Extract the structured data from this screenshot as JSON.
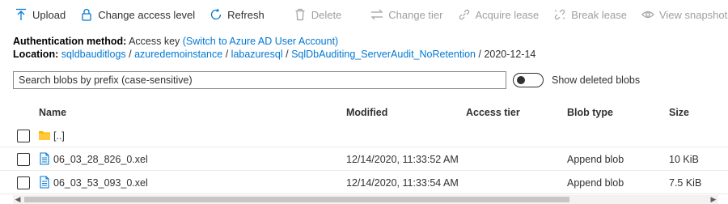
{
  "toolbar": {
    "upload": "Upload",
    "change_access": "Change access level",
    "refresh": "Refresh",
    "delete": "Delete",
    "change_tier": "Change tier",
    "acquire_lease": "Acquire lease",
    "break_lease": "Break lease",
    "view_snapshots": "View snapshots",
    "more": "···"
  },
  "auth": {
    "label": "Authentication method:",
    "value": "Access key",
    "switch_link": "(Switch to Azure AD User Account)"
  },
  "location": {
    "label": "Location:",
    "crumbs": [
      "sqldbauditlogs",
      "azuredemoinstance",
      "labazuresql",
      "SqlDbAuditing_ServerAudit_NoRetention"
    ],
    "separator": "/",
    "current": "2020-12-14"
  },
  "search": {
    "placeholder": "Search blobs by prefix (case-sensitive)"
  },
  "toggle": {
    "label": "Show deleted blobs",
    "on": false
  },
  "table": {
    "headers": {
      "name": "Name",
      "modified": "Modified",
      "access_tier": "Access tier",
      "blob_type": "Blob type",
      "size": "Size"
    },
    "rows": [
      {
        "name": "[..]",
        "modified": "",
        "access_tier": "",
        "blob_type": "",
        "size": "",
        "icon": "folder-icon"
      },
      {
        "name": "06_03_28_826_0.xel",
        "modified": "12/14/2020, 11:33:52 AM",
        "access_tier": "",
        "blob_type": "Append blob",
        "size": "10 KiB",
        "icon": "file-icon"
      },
      {
        "name": "06_03_53_093_0.xel",
        "modified": "12/14/2020, 11:33:54 AM",
        "access_tier": "",
        "blob_type": "Append blob",
        "size": "7.5 KiB",
        "icon": "file-icon"
      }
    ]
  },
  "colors": {
    "accent": "#0078d4",
    "folder": "#ffb900",
    "disabled": "#a19f9d"
  }
}
